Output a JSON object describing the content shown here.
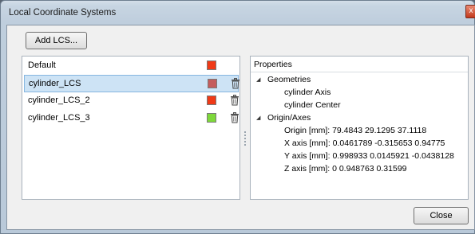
{
  "window": {
    "title": "Local Coordinate Systems",
    "close_glyph": "x"
  },
  "toolbar": {
    "add_label": "Add LCS..."
  },
  "lcs_list": {
    "items": [
      {
        "name": "Default",
        "color": "#f03a17",
        "deletable": false,
        "selected": false
      },
      {
        "name": "cylinder_LCS",
        "color": "#c45c5c",
        "deletable": true,
        "selected": true
      },
      {
        "name": "cylinder_LCS_2",
        "color": "#f03a17",
        "deletable": true,
        "selected": false
      },
      {
        "name": "cylinder_LCS_3",
        "color": "#7ed83a",
        "deletable": true,
        "selected": false
      }
    ],
    "delete_icon": "trash-icon"
  },
  "properties": {
    "header": "Properties",
    "geometries": {
      "label": "Geometries",
      "items": [
        "cylinder Axis",
        "cylinder Center"
      ]
    },
    "origin_axes": {
      "label": "Origin/Axes",
      "items": [
        "Origin [mm]: 79.4843 29.1295 37.1118",
        "X axis [mm]: 0.0461789 -0.315653 0.94775",
        "Y axis [mm]: 0.998933 0.0145921 -0.0438128",
        "Z axis [mm]: 0 0.948763 0.31599"
      ]
    },
    "expand_glyph": "◢"
  },
  "footer": {
    "close_label": "Close"
  }
}
